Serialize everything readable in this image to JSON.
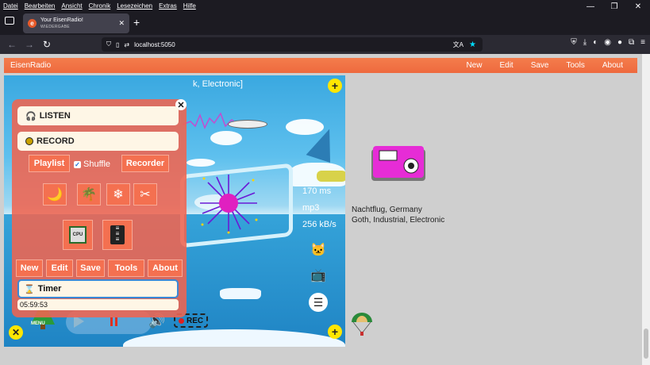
{
  "browser": {
    "menu": [
      "Datei",
      "Bearbeiten",
      "Ansicht",
      "Chronik",
      "Lesezeichen",
      "Extras",
      "Hilfe"
    ],
    "tab": {
      "title": "Your EisenRadio!",
      "subtitle": "WIEDERGABE"
    },
    "url": "localhost:5050"
  },
  "app": {
    "brand": "EisenRadio",
    "nav": [
      "New",
      "Edit",
      "Save",
      "Tools",
      "About"
    ]
  },
  "scene": {
    "title_peek": "k, Electronic]",
    "stats": {
      "latency": "170 ms",
      "codec": "mp3",
      "bitrate": "256 kB/s"
    },
    "rec_label": "REC",
    "menu_label": "MENU"
  },
  "overlay": {
    "listen_label": "LISTEN",
    "record_label": "RECORD",
    "playlist_label": "Playlist",
    "shuffle_label": "Shuffle",
    "recorder_label": "Recorder",
    "cpu_label": "CPU",
    "buttons": [
      "New",
      "Edit",
      "Save",
      "Tools",
      "About"
    ],
    "timer_label": "Timer",
    "timer_value": "05:59:53"
  },
  "station": {
    "name": "Nachtflug, Germany",
    "genre": "Goth, Industrial, Electronic"
  }
}
